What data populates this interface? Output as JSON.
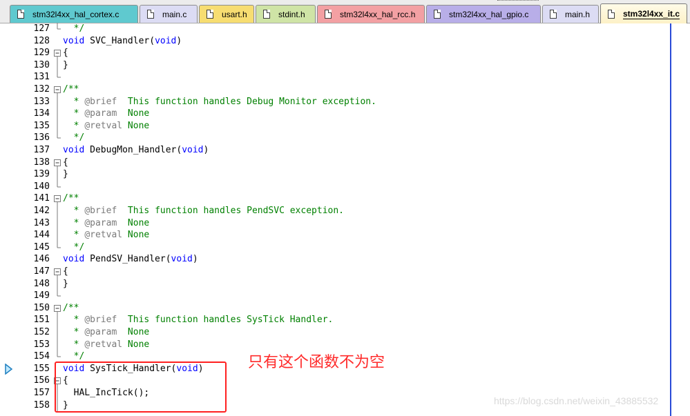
{
  "tabs": [
    {
      "label": "stm32l4xx_hal_cortex.c",
      "color": "#5fc9cf",
      "active": false
    },
    {
      "label": "main.c",
      "color": "#dcdcf4",
      "active": false
    },
    {
      "label": "usart.h",
      "color": "#f7dd71",
      "active": false
    },
    {
      "label": "stdint.h",
      "color": "#cfe4a6",
      "active": false
    },
    {
      "label": "stm32l4xx_hal_rcc.h",
      "color": "#f3a0a3",
      "active": false
    },
    {
      "label": "stm32l4xx_hal_gpio.c",
      "color": "#b8aee8",
      "active": false
    },
    {
      "label": "main.h",
      "color": "#dcdcf4",
      "active": false
    },
    {
      "label": "stm32l4xx_it.c",
      "color": "#fdf1c7",
      "active": true
    }
  ],
  "lines": [
    {
      "n": "127",
      "text": "  */"
    },
    {
      "n": "128",
      "text": "void SVC_Handler(void)"
    },
    {
      "n": "129",
      "text": "{"
    },
    {
      "n": "130",
      "text": "}"
    },
    {
      "n": "131",
      "text": ""
    },
    {
      "n": "132",
      "text": "/**"
    },
    {
      "n": "133",
      "text": "  * @brief  This function handles Debug Monitor exception."
    },
    {
      "n": "134",
      "text": "  * @param  None"
    },
    {
      "n": "135",
      "text": "  * @retval None"
    },
    {
      "n": "136",
      "text": "  */"
    },
    {
      "n": "137",
      "text": "void DebugMon_Handler(void)"
    },
    {
      "n": "138",
      "text": "{"
    },
    {
      "n": "139",
      "text": "}"
    },
    {
      "n": "140",
      "text": ""
    },
    {
      "n": "141",
      "text": "/**"
    },
    {
      "n": "142",
      "text": "  * @brief  This function handles PendSVC exception."
    },
    {
      "n": "143",
      "text": "  * @param  None"
    },
    {
      "n": "144",
      "text": "  * @retval None"
    },
    {
      "n": "145",
      "text": "  */"
    },
    {
      "n": "146",
      "text": "void PendSV_Handler(void)"
    },
    {
      "n": "147",
      "text": "{"
    },
    {
      "n": "148",
      "text": "}"
    },
    {
      "n": "149",
      "text": ""
    },
    {
      "n": "150",
      "text": "/**"
    },
    {
      "n": "151",
      "text": "  * @brief  This function handles SysTick Handler."
    },
    {
      "n": "152",
      "text": "  * @param  None"
    },
    {
      "n": "153",
      "text": "  * @retval None"
    },
    {
      "n": "154",
      "text": "  */"
    },
    {
      "n": "155",
      "text": "void SysTick_Handler(void)"
    },
    {
      "n": "156",
      "text": "{"
    },
    {
      "n": "157",
      "text": "  HAL_IncTick();"
    },
    {
      "n": "158",
      "text": "}"
    }
  ],
  "annotation": "只有这个函数不为空",
  "watermark": "https://blog.csdn.net/weixin_43885532",
  "colors": {
    "keyword": "#0000ff",
    "comment": "#008000",
    "highlight": "#ff1f1f",
    "caret_line": "#2a4bd7"
  }
}
